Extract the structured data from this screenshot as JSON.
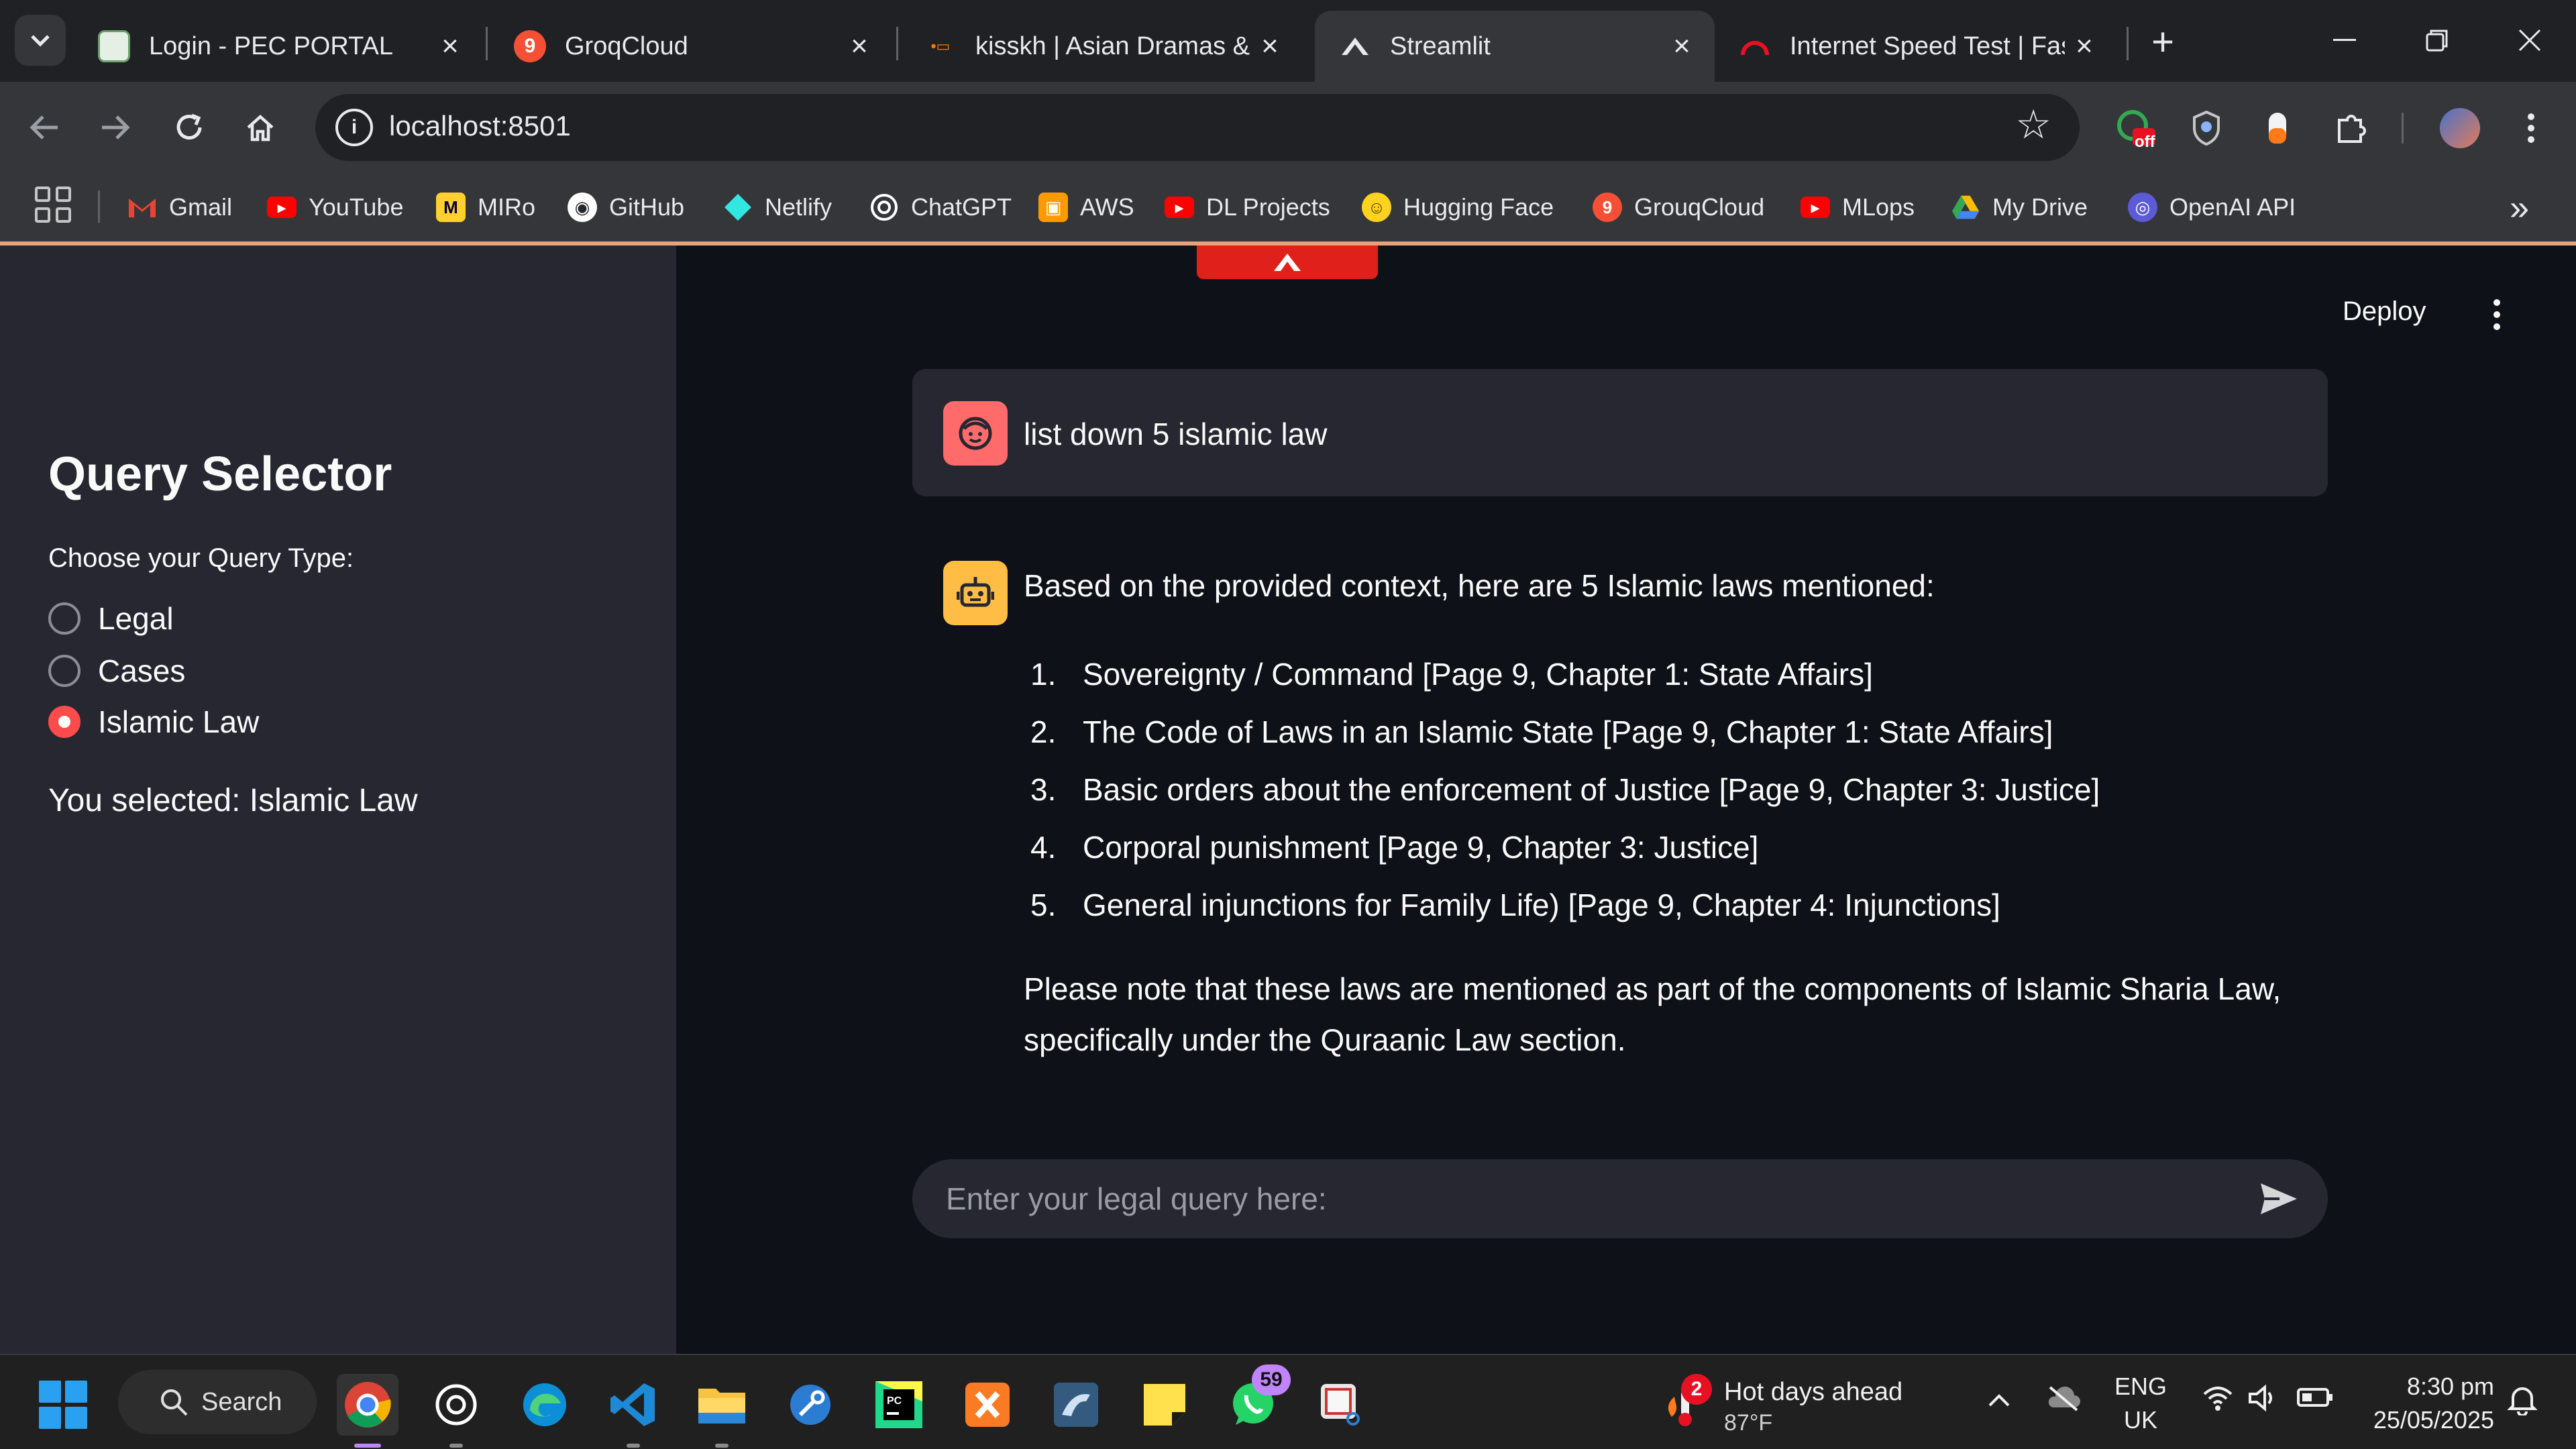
{
  "browser": {
    "tabs": [
      {
        "title": "Login - PEC PORTAL",
        "icon": "pec-portal-icon",
        "active": false
      },
      {
        "title": "GroqCloud",
        "icon": "groq-icon",
        "active": false
      },
      {
        "title": "kisskh | Asian Dramas & M",
        "icon": "kisskh-icon",
        "active": false
      },
      {
        "title": "Streamlit",
        "icon": "streamlit-icon",
        "active": true
      },
      {
        "title": "Internet Speed Test | Fast",
        "icon": "fast-speedometer-icon",
        "active": false
      }
    ],
    "url": "localhost:8501",
    "extension_badge": "off",
    "bookmarks": [
      {
        "label": "Gmail",
        "icon": "gmail-icon",
        "color": "#ea4335"
      },
      {
        "label": "YouTube",
        "icon": "youtube-icon",
        "color": "#ff0000"
      },
      {
        "label": "MIRo",
        "icon": "miro-icon",
        "color": "#ffd02f"
      },
      {
        "label": "GitHub",
        "icon": "github-icon",
        "color": "#ffffff"
      },
      {
        "label": "Netlify",
        "icon": "netlify-icon",
        "color": "#32e6e2"
      },
      {
        "label": "ChatGPT",
        "icon": "openai-icon",
        "color": "#ffffff"
      },
      {
        "label": "AWS",
        "icon": "aws-icon",
        "color": "#ff9900"
      },
      {
        "label": "DL Projects",
        "icon": "youtube-icon",
        "color": "#ff0000"
      },
      {
        "label": "Hugging Face",
        "icon": "hugging-face-icon",
        "color": "#ffd21e"
      },
      {
        "label": "GrouqCloud",
        "icon": "groq-icon",
        "color": "#f55036"
      },
      {
        "label": "MLops",
        "icon": "youtube-icon",
        "color": "#ff0000"
      },
      {
        "label": "My Drive",
        "icon": "google-drive-icon",
        "color": "#34a853"
      },
      {
        "label": "OpenAI API",
        "icon": "openai-icon",
        "color": "#5b5bd6"
      }
    ]
  },
  "sidebar": {
    "title": "Query Selector",
    "radio_label": "Choose your Query Type:",
    "options": [
      {
        "label": "Legal",
        "checked": false
      },
      {
        "label": "Cases",
        "checked": false
      },
      {
        "label": "Islamic Law",
        "checked": true
      }
    ],
    "selected_text": "You selected: Islamic Law"
  },
  "header": {
    "deploy_label": "Deploy"
  },
  "chat": {
    "user_message": "list down 5 islamic law",
    "assistant_intro": "Based on the provided context, here are 5 Islamic laws mentioned:",
    "assistant_list": [
      {
        "num": "1.",
        "text": "Sovereignty / Command [Page 9, Chapter 1: State Affairs]"
      },
      {
        "num": "2.",
        "text": "The Code of Laws in an Islamic State [Page 9, Chapter 1: State Affairs]"
      },
      {
        "num": "3.",
        "text": "Basic orders about the enforcement of Justice [Page 9, Chapter 3: Justice]"
      },
      {
        "num": "4.",
        "text": "Corporal punishment [Page 9, Chapter 3: Justice]"
      },
      {
        "num": "5.",
        "text": "General injunctions for Family Life) [Page 9, Chapter 4: Injunctions]"
      }
    ],
    "assistant_note": "Please note that these laws are mentioned as part of the components of Islamic Sharia Law, specifically under the Quraanic Law section.",
    "input_placeholder": "Enter your legal query here:"
  },
  "taskbar": {
    "search_label": "Search",
    "whatsapp_badge": "59",
    "weather_badge": "2",
    "weather_title": "Hot days ahead",
    "weather_temp": "87°F",
    "lang_line1": "ENG",
    "lang_line2": "UK",
    "time": "8:30 pm",
    "date": "25/05/2025"
  },
  "colors": {
    "accent": "#ff4b4b",
    "sidebar_bg": "#262730",
    "main_bg": "#0e1117",
    "user_avatar": "#ff6b6b",
    "bot_avatar": "#ffbd45"
  }
}
